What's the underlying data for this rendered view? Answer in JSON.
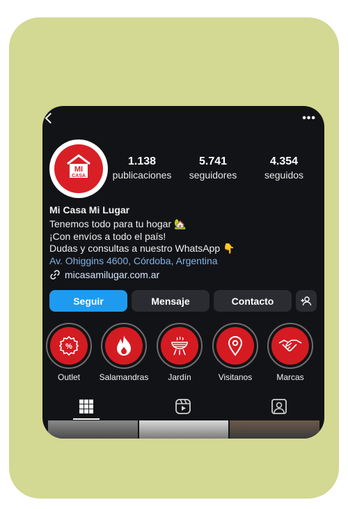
{
  "profile": {
    "stats": [
      {
        "value": "1.138",
        "label": "publicaciones"
      },
      {
        "value": "5.741",
        "label": "seguidores"
      },
      {
        "value": "4.354",
        "label": "seguidos"
      }
    ],
    "logo_text_top": "MI",
    "logo_text_bottom": "CASA",
    "name": "Mi Casa Mi Lugar",
    "bio": [
      "Tenemos todo para tu hogar 🏡",
      "¡Con envíos a todo el país!",
      "Dudas y consultas a nuestro WhatsApp 👇"
    ],
    "address": "Av. Ohiggins 4600, Córdoba, Argentina",
    "website": "micasamilugar.com.ar"
  },
  "actions": {
    "follow": "Seguir",
    "message": "Mensaje",
    "contact": "Contacto"
  },
  "highlights": [
    {
      "label": "Outlet",
      "icon": "discount-badge-icon"
    },
    {
      "label": "Salamandras",
      "icon": "flame-icon"
    },
    {
      "label": "Jardín",
      "icon": "grill-icon"
    },
    {
      "label": "Visitanos",
      "icon": "location-pin-icon"
    },
    {
      "label": "Marcas",
      "icon": "handshake-icon"
    }
  ],
  "tabs": [
    "grid-icon",
    "reels-icon",
    "tagged-icon"
  ],
  "colors": {
    "frame": "#d3d892",
    "background": "#121316",
    "brand_red": "#d81f26",
    "follow_blue": "#1d9bf0"
  }
}
